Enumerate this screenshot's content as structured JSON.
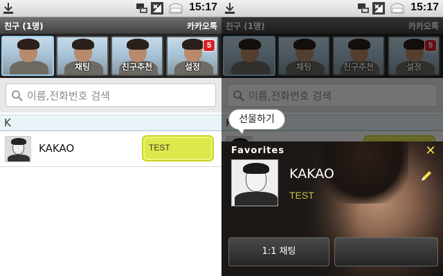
{
  "status_bar": {
    "time": "15:17",
    "icons": [
      "download-icon",
      "usb-debug-icon",
      "signal-icon",
      "battery-icon"
    ]
  },
  "title_bar": {
    "title": "친구 (1명)",
    "app_name": "카카오톡"
  },
  "tabs": [
    {
      "label": "",
      "icon": "friends-tab-photo"
    },
    {
      "label": "채팅",
      "icon": "chat-tab-photo"
    },
    {
      "label": "친구추천",
      "icon": "recommend-tab-photo"
    },
    {
      "label": "설정",
      "icon": "settings-tab-photo",
      "badge": "5"
    }
  ],
  "search": {
    "placeholder": "이름,전화번호 검색"
  },
  "friend_list": {
    "section_header": "K",
    "friends": [
      {
        "name": "KAKAO",
        "status_message": "TEST"
      }
    ]
  },
  "gift_bubble": {
    "label": "선물하기"
  },
  "favorites_popup": {
    "title": "Favorites",
    "name": "KAKAO",
    "status_message": "TEST",
    "chat_button": "1:1 채팅",
    "second_button": ""
  },
  "colors": {
    "status_message_bg": "#dde84a",
    "accent_yellow": "#f3e14b",
    "section_bg": "#e9f3f8",
    "badge_red": "#d8232a"
  }
}
